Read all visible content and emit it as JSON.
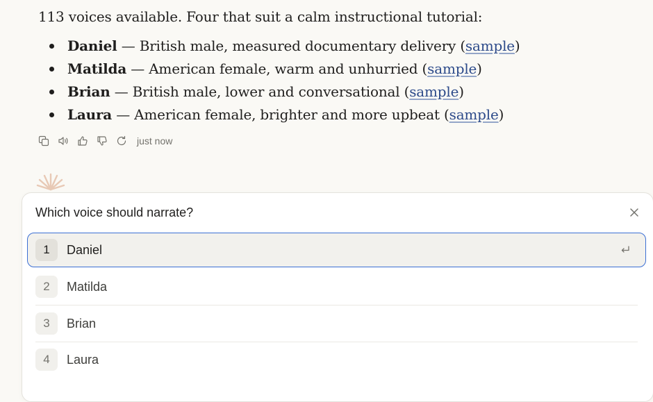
{
  "message": {
    "intro": "113 voices available. Four that suit a calm instructional tutorial:",
    "voices": [
      {
        "name": "Daniel",
        "desc": " — British male, measured documentary delivery (",
        "link": "sample",
        "close": ")"
      },
      {
        "name": "Matilda",
        "desc": " — American female, warm and unhurried (",
        "link": "sample",
        "close": ")"
      },
      {
        "name": "Brian",
        "desc": " — British male, lower and conversational (",
        "link": "sample",
        "close": ")"
      },
      {
        "name": "Laura",
        "desc": " — American female, brighter and more upbeat (",
        "link": "sample",
        "close": ")"
      }
    ]
  },
  "actions": {
    "icons": [
      "copy-icon",
      "speaker-icon",
      "thumbs-up-icon",
      "thumbs-down-icon",
      "retry-icon"
    ],
    "timestamp": "just now"
  },
  "prompt": {
    "title": "Which voice should narrate?",
    "options": [
      {
        "num": "1",
        "label": "Daniel"
      },
      {
        "num": "2",
        "label": "Matilda"
      },
      {
        "num": "3",
        "label": "Brian"
      },
      {
        "num": "4",
        "label": "Laura"
      }
    ],
    "selected_index": 0
  },
  "colors": {
    "background": "#faf9f5",
    "link": "#2c4a8a",
    "selection_border": "#3b6fd4",
    "spark": "#e8c9b5"
  }
}
